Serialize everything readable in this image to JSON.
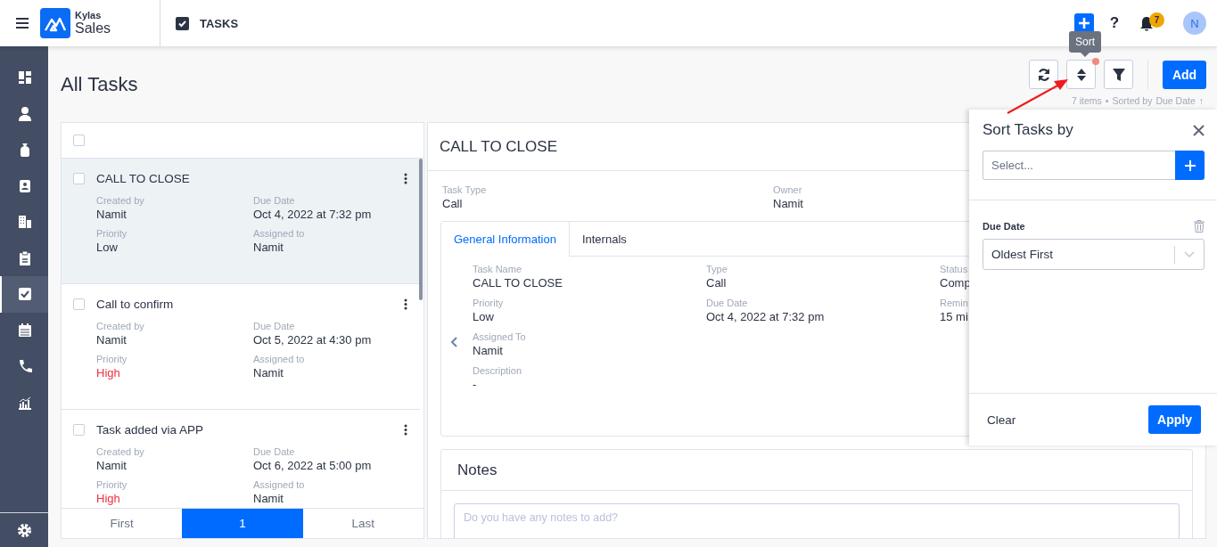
{
  "header": {
    "brand_small": "Kylas",
    "brand_large": "Sales",
    "module": "TASKS",
    "help": "?",
    "notification_count": "7",
    "avatar": "N"
  },
  "sidebar": {
    "items": [
      {
        "selected": false
      },
      {
        "selected": false
      },
      {
        "selected": false
      },
      {
        "selected": false
      },
      {
        "selected": false
      },
      {
        "selected": false
      },
      {
        "selected": true
      },
      {
        "selected": false
      },
      {
        "selected": false
      },
      {
        "selected": false
      }
    ]
  },
  "page": {
    "title": "All Tasks",
    "tooltip": "Sort",
    "sort_active": true,
    "add_button": "Add",
    "meta": {
      "count": "7 items",
      "separator": "•",
      "sorted_by": "Sorted by",
      "sort_field": "Due Date",
      "sort_direction": "↑"
    }
  },
  "task_list": {
    "select_all_checked": false,
    "items": [
      {
        "title": "CALL TO CLOSE",
        "selected": true,
        "checked": false,
        "fields": [
          {
            "label": "Created by",
            "value": "Namit"
          },
          {
            "label": "Due Date",
            "value": "Oct 4, 2022 at 7:32 pm"
          },
          {
            "label": "Priority",
            "value": "Low",
            "color": "#2c3345"
          },
          {
            "label": "Assigned to",
            "value": "Namit"
          }
        ]
      },
      {
        "title": "Call to confirm",
        "selected": false,
        "checked": false,
        "fields": [
          {
            "label": "Created by",
            "value": "Namit"
          },
          {
            "label": "Due Date",
            "value": "Oct 5, 2022 at 4:30 pm"
          },
          {
            "label": "Priority",
            "value": "High",
            "color": "#f0303f"
          },
          {
            "label": "Assigned to",
            "value": "Namit"
          }
        ]
      },
      {
        "title": "Task added via APP",
        "selected": false,
        "checked": false,
        "fields": [
          {
            "label": "Created by",
            "value": "Namit"
          },
          {
            "label": "Due Date",
            "value": "Oct 6, 2022 at 5:00 pm"
          },
          {
            "label": "Priority",
            "value": "High",
            "color": "#f0303f"
          },
          {
            "label": "Assigned to",
            "value": "Namit"
          }
        ]
      }
    ],
    "pagination": [
      {
        "label": "First",
        "selected": false
      },
      {
        "label": "1",
        "selected": true
      },
      {
        "label": "Last",
        "selected": false
      }
    ]
  },
  "detail": {
    "title": "CALL TO CLOSE",
    "summary": [
      {
        "label": "Task Type",
        "value": "Call"
      },
      {
        "label": "Owner",
        "value": "Namit"
      }
    ],
    "tabs": [
      {
        "label": "General Information",
        "selected": true
      },
      {
        "label": "Internals",
        "selected": false
      }
    ],
    "columns": [
      {
        "fields": [
          {
            "label": "Task Name",
            "value": "CALL TO CLOSE"
          },
          {
            "label": "Priority",
            "value": "Low"
          },
          {
            "label": "Assigned To",
            "value": "Namit"
          },
          {
            "label": "Description",
            "value": "-"
          }
        ]
      },
      {
        "fields": [
          {
            "label": "Type",
            "value": "Call"
          },
          {
            "label": "Due Date",
            "value": "Oct 4, 2022 at 7:32 pm"
          }
        ]
      },
      {
        "fields": [
          {
            "label": "Status",
            "value": "Comp"
          },
          {
            "label": "Remin",
            "value": "15 mi"
          }
        ]
      }
    ],
    "notes": {
      "title": "Notes",
      "placeholder": "Do you have any notes to add?"
    }
  },
  "sort_panel": {
    "title": "Sort Tasks by",
    "select_placeholder": "Select...",
    "criteria": [
      {
        "field": "Due Date",
        "value": "Oldest First"
      }
    ],
    "clear_button": "Clear",
    "apply_button": "Apply"
  }
}
